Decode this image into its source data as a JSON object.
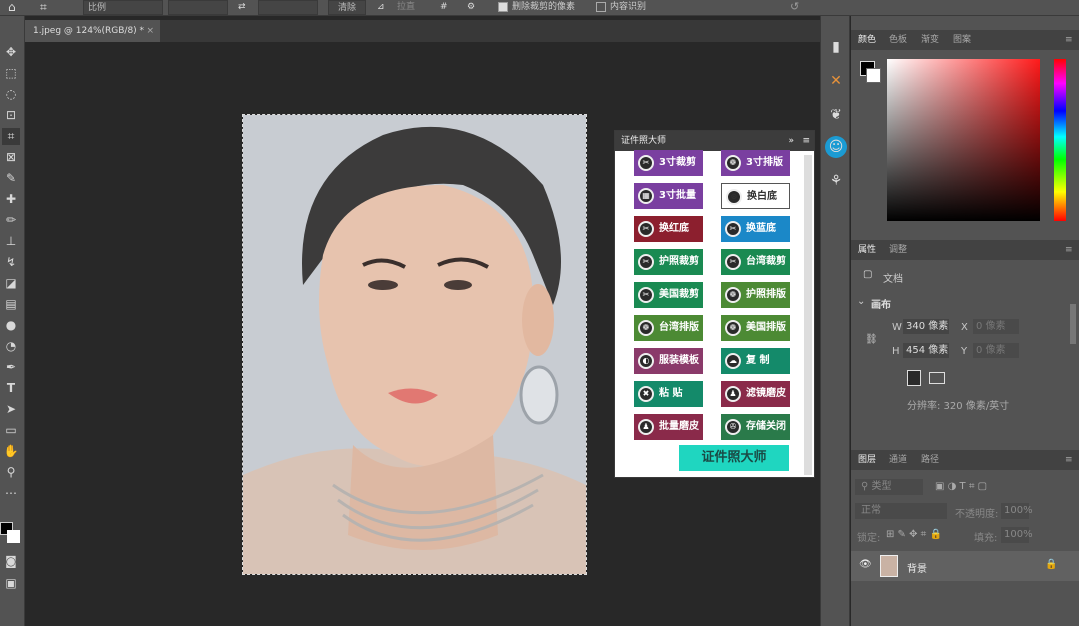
{
  "optbar": {
    "ratio": "比例",
    "clear": "清除",
    "straighten": "拉直",
    "delete_cropped": "删除裁剪的像素",
    "content_aware": "内容识别"
  },
  "doc_tab": {
    "title": "1.jpeg @ 124%(RGB/8\u0002) *"
  },
  "plugin": {
    "title": "证件照大师",
    "buttons": [
      {
        "label": "3寸裁剪",
        "color": "#7a3fa0"
      },
      {
        "label": "3寸排版",
        "color": "#7a3fa0"
      },
      {
        "label": "3寸批量",
        "color": "#7a3fa0"
      },
      {
        "label": "换白底",
        "color": "#ffffff"
      },
      {
        "label": "换红底",
        "color": "#8c1f2e"
      },
      {
        "label": "换蓝底",
        "color": "#1b88c8"
      },
      {
        "label": "护照裁剪",
        "color": "#1a8a52"
      },
      {
        "label": "台湾裁剪",
        "color": "#1a8a52"
      },
      {
        "label": "美国裁剪",
        "color": "#1a8a52"
      },
      {
        "label": "护照排版",
        "color": "#4c8a34"
      },
      {
        "label": "台湾排版",
        "color": "#4c8a34"
      },
      {
        "label": "美国排版",
        "color": "#4c8a34"
      },
      {
        "label": "服装模板",
        "color": "#8a3a6a"
      },
      {
        "label": "复 制",
        "color": "#148a6a"
      },
      {
        "label": "粘 贴",
        "color": "#148a6a"
      },
      {
        "label": "滤镜磨皮",
        "color": "#8a2a4a"
      },
      {
        "label": "批量磨皮",
        "color": "#8a2a4a"
      },
      {
        "label": "存储关闭",
        "color": "#2a7a4a"
      }
    ],
    "brand": "证件照大师"
  },
  "right": {
    "color_tabs": [
      "颜色",
      "色板",
      "渐变",
      "图案"
    ],
    "prop_tabs": [
      "属性",
      "调整"
    ],
    "doc_label": "文档",
    "canvas_label": "画布",
    "w_label": "W",
    "w_value": "340 像素",
    "h_label": "H",
    "h_value": "454 像素",
    "x_label": "X",
    "x_placeholder": "0 像素",
    "y_label": "Y",
    "y_placeholder": "0 像素",
    "resolution": "分辨率: 320 像素/英寸",
    "layer_tabs": [
      "图层",
      "通道",
      "路径"
    ],
    "layer_search": "类型",
    "blend_mode": "正常",
    "opacity_label": "不透明度:",
    "opacity_value": "100%",
    "lock_label": "锁定:",
    "fill_label": "填充:",
    "fill_value": "100%",
    "layer_name": "背景"
  }
}
